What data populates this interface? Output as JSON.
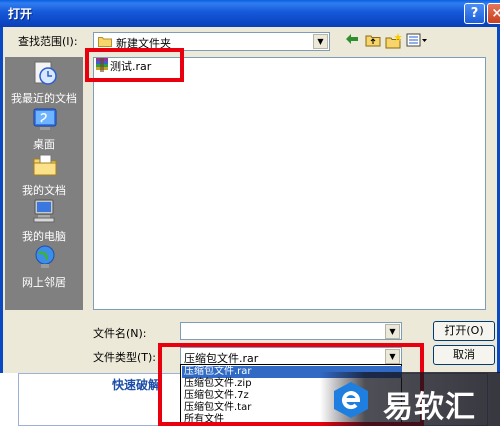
{
  "window": {
    "title": "打开",
    "help_glyph": "?",
    "close_glyph": "×"
  },
  "lookin": {
    "label": "查找范围(I):",
    "value": "新建文件夹"
  },
  "toolbar": {
    "back_icon": "back-arrow-icon",
    "up_icon": "up-folder-icon",
    "new_folder_icon": "new-folder-icon",
    "views_icon": "views-menu-icon"
  },
  "places": [
    {
      "label": "我最近的文档",
      "icon": "recent-documents-icon"
    },
    {
      "label": "桌面",
      "icon": "desktop-icon"
    },
    {
      "label": "我的文档",
      "icon": "my-documents-icon"
    },
    {
      "label": "我的电脑",
      "icon": "my-computer-icon"
    },
    {
      "label": "网上邻居",
      "icon": "network-places-icon"
    }
  ],
  "files": [
    {
      "name": "测试.rar",
      "icon": "winrar-archive-icon"
    }
  ],
  "filename": {
    "label": "文件名(N):",
    "value": ""
  },
  "filetype": {
    "label": "文件类型(T):",
    "value": "压缩包文件.rar",
    "options": [
      "压缩包文件.rar",
      "压缩包文件.zip",
      "压缩包文件.7z",
      "压缩包文件.tar",
      "所有文件"
    ]
  },
  "buttons": {
    "open": "打开(O)",
    "cancel": "取消"
  },
  "background": {
    "partial_text": "快速破解"
  },
  "watermark": {
    "text": "易软汇"
  },
  "colors": {
    "highlight": "#e8000e",
    "titlebar": "#0c48c6",
    "selection": "#316ac5"
  }
}
